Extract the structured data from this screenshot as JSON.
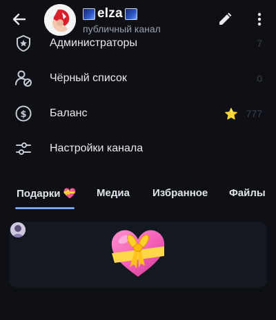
{
  "header": {
    "title": "elza",
    "subtitle": "публичный канал"
  },
  "menu": [
    {
      "label": "Администраторы",
      "value": "7",
      "icon": "admin-badge-icon"
    },
    {
      "label": "Чёрный список",
      "value": "0",
      "icon": "blocked-user-icon"
    },
    {
      "label": "Баланс",
      "value": "777",
      "icon": "dollar-circle-icon",
      "star": "⭐"
    },
    {
      "label": "Настройки канала",
      "value": "",
      "icon": "sliders-icon"
    }
  ],
  "tabs": {
    "items": [
      "Подарки",
      "Медиа",
      "Избранное",
      "Файлы"
    ],
    "gift_emoji": "💝",
    "active": 0,
    "accent": "#7ba3e8"
  },
  "gift": {
    "emoji_name": "heart-with-ribbon"
  },
  "colors": {
    "background": "#0e1016",
    "card": "#141821",
    "text": "#e8eaf0"
  }
}
